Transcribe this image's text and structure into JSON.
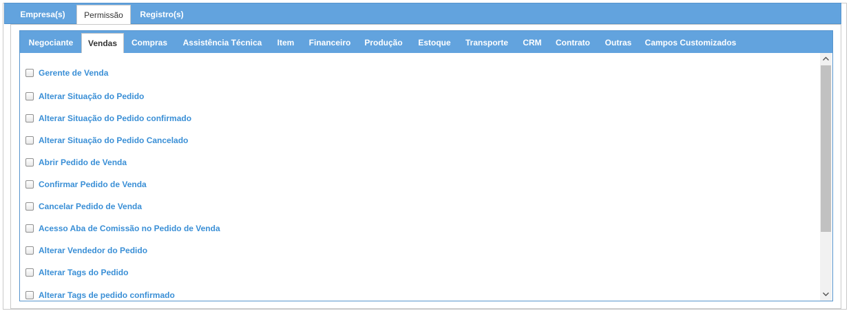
{
  "top_tabs": [
    {
      "label": "Empresa(s)",
      "active": false
    },
    {
      "label": "Permissão",
      "active": true
    },
    {
      "label": "Registro(s)",
      "active": false
    }
  ],
  "sub_tabs": [
    {
      "label": "Negociante",
      "active": false
    },
    {
      "label": "Vendas",
      "active": true
    },
    {
      "label": "Compras",
      "active": false
    },
    {
      "label": "Assistência Técnica",
      "active": false
    },
    {
      "label": "Item",
      "active": false
    },
    {
      "label": "Financeiro",
      "active": false
    },
    {
      "label": "Produção",
      "active": false
    },
    {
      "label": "Estoque",
      "active": false
    },
    {
      "label": "Transporte",
      "active": false
    },
    {
      "label": "CRM",
      "active": false
    },
    {
      "label": "Contrato",
      "active": false
    },
    {
      "label": "Outras",
      "active": false
    },
    {
      "label": "Campos Customizados",
      "active": false
    }
  ],
  "permissions": [
    {
      "label": "Gerente de Venda",
      "checked": false
    },
    {
      "label": "Alterar Situação do Pedido",
      "checked": false
    },
    {
      "label": "Alterar Situação do Pedido confirmado",
      "checked": false
    },
    {
      "label": "Alterar Situação do Pedido Cancelado",
      "checked": false
    },
    {
      "label": "Abrir Pedido de Venda",
      "checked": false
    },
    {
      "label": "Confirmar Pedido de Venda",
      "checked": false
    },
    {
      "label": "Cancelar Pedido de Venda",
      "checked": false
    },
    {
      "label": "Acesso Aba de Comissão no Pedido de Venda",
      "checked": false
    },
    {
      "label": "Alterar Vendedor do Pedido",
      "checked": false
    },
    {
      "label": "Alterar Tags do Pedido",
      "checked": false
    },
    {
      "label": "Alterar Tags de pedido confirmado",
      "checked": false
    }
  ],
  "colors": {
    "tabbar_bg": "#62a3de",
    "label_blue": "#3a8fd6"
  },
  "icons": {
    "scroll_up": "chevron-up-icon",
    "scroll_down": "chevron-down-icon"
  }
}
